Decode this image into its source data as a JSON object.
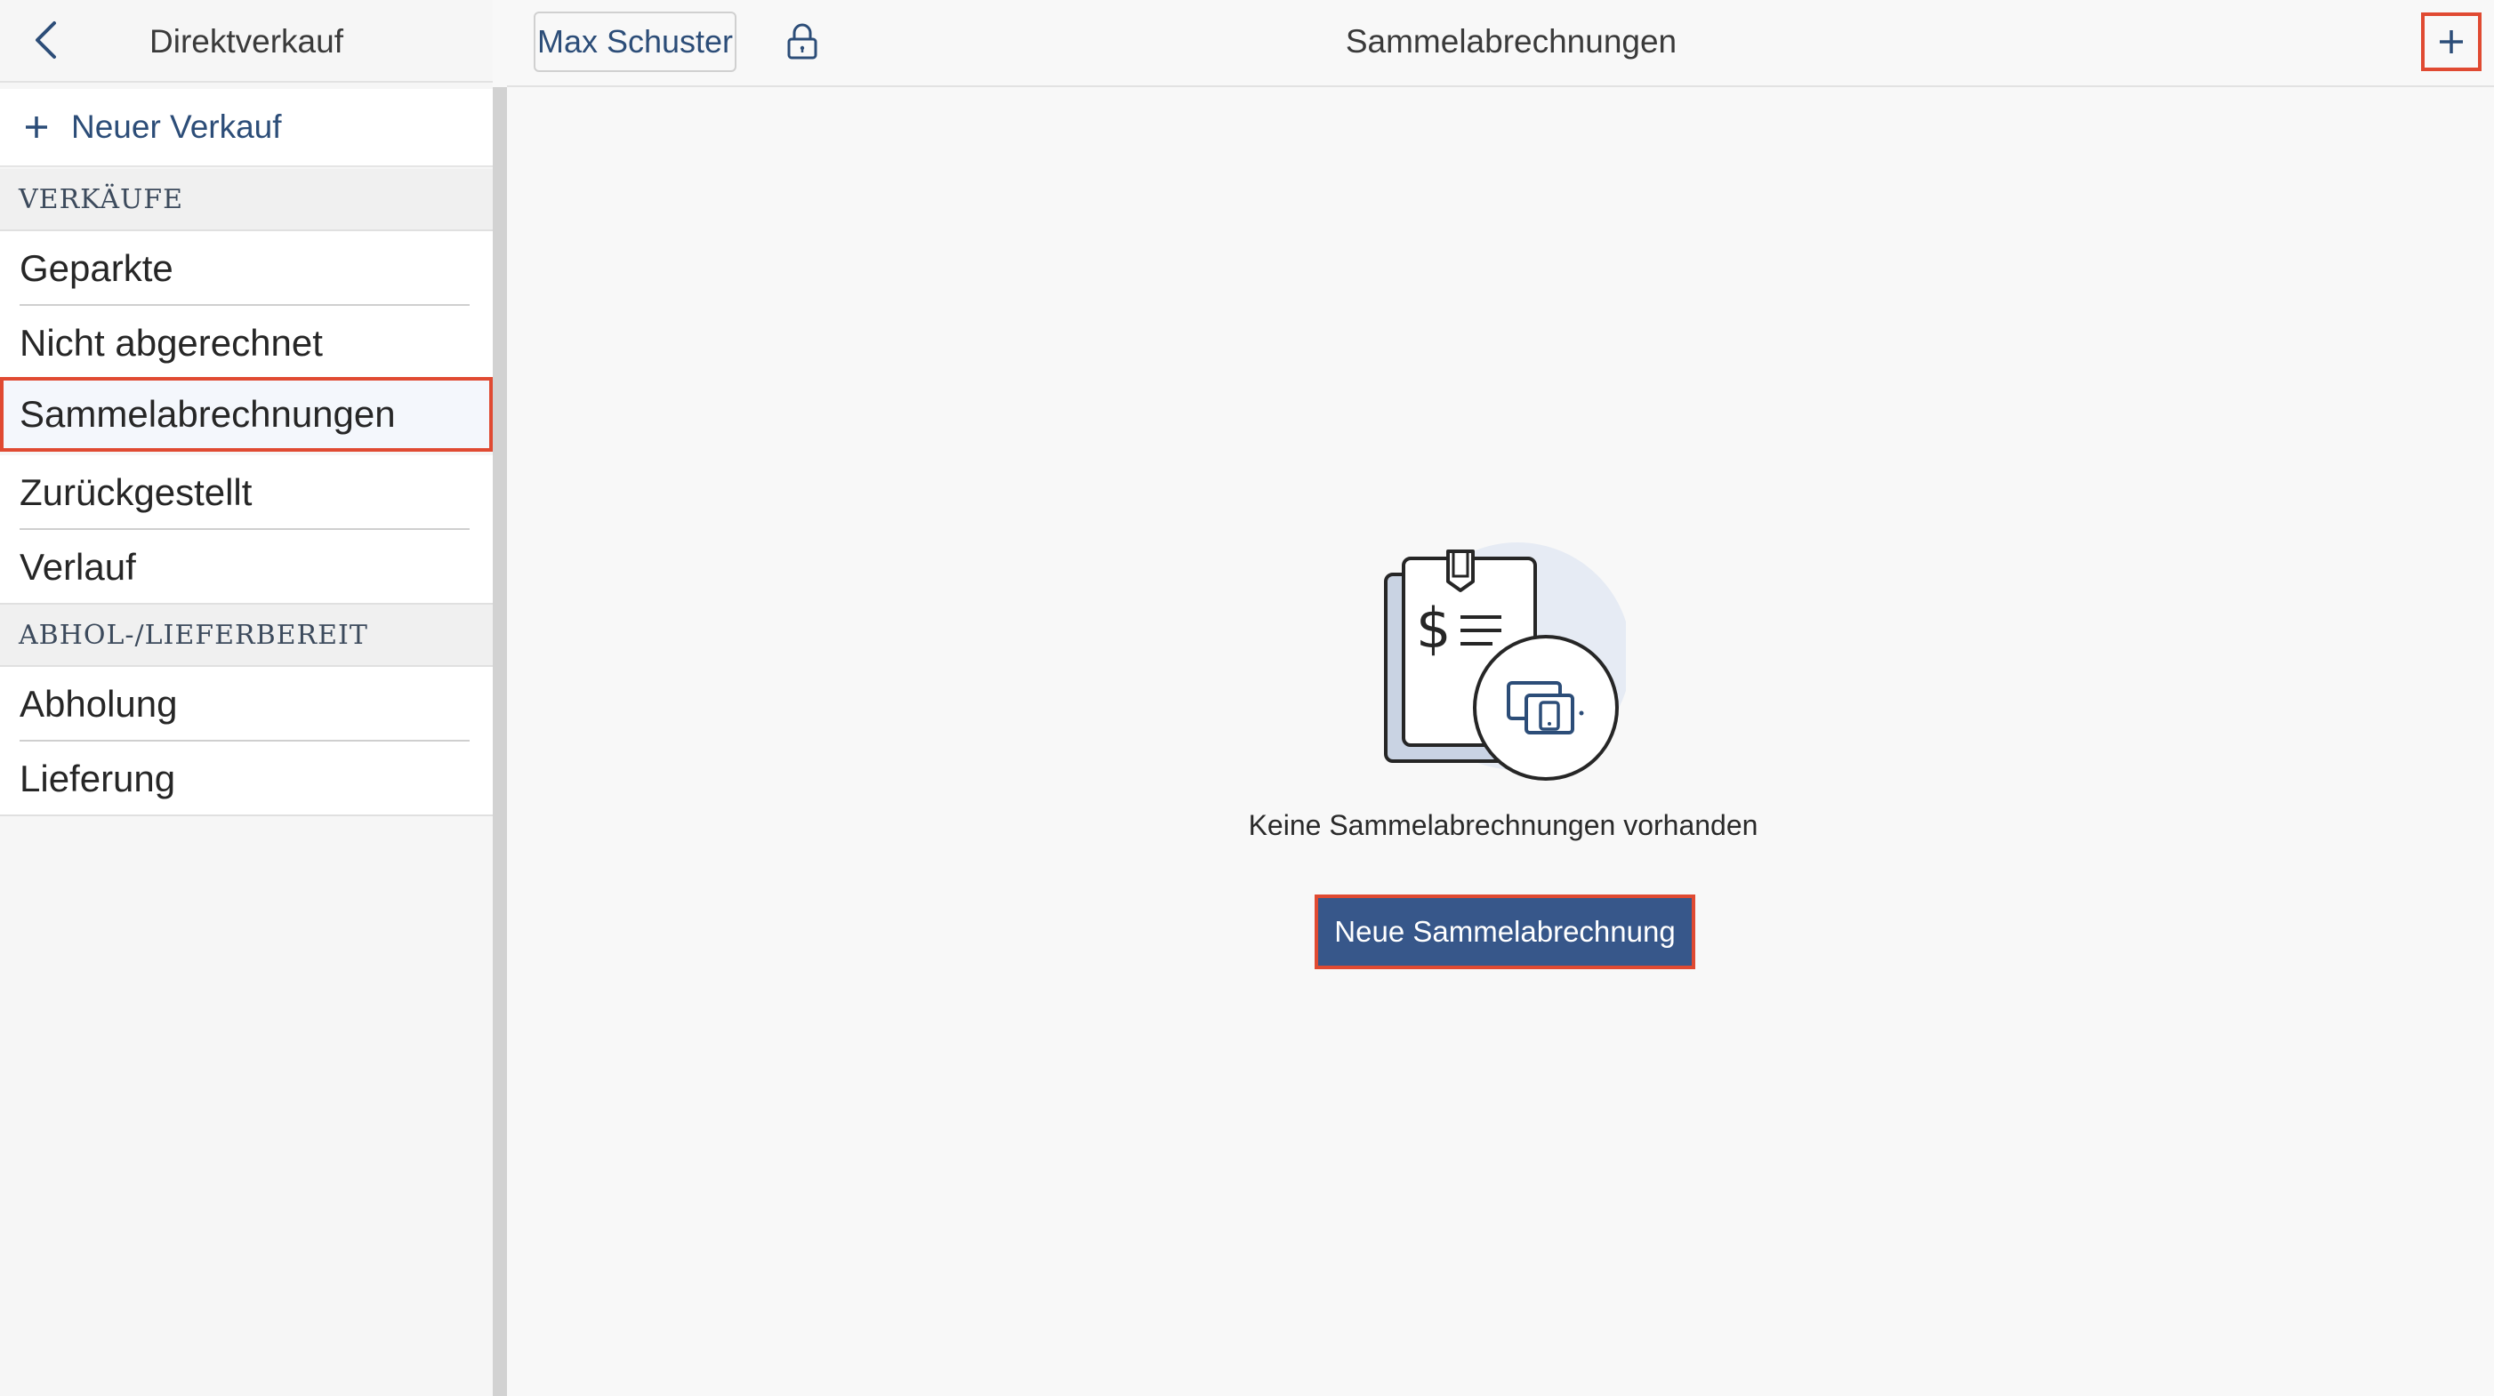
{
  "sidebar": {
    "title": "Direktverkauf",
    "new_sale_label": "Neuer Verkauf",
    "sections": [
      {
        "header": "VERKÄUFE",
        "items": [
          "Geparkte",
          "Nicht abgerechnet",
          "Sammelabrechnungen",
          "Zurückgestellt",
          "Verlauf"
        ]
      },
      {
        "header": "ABHOL-/LIEFERBEREIT",
        "items": [
          "Abholung",
          "Lieferung"
        ]
      }
    ],
    "active_item": "Sammelabrechnungen"
  },
  "header": {
    "user_label": "Max Schuster",
    "title": "Sammelabrechnungen"
  },
  "main": {
    "empty_text": "Keine Sammelabrechnungen vorhanden",
    "primary_button_label": "Neue Sammelabrechnung"
  },
  "icons": {
    "back": "chevron-left-icon",
    "new_sale": "plus-icon",
    "lock": "lock-icon",
    "add": "plus-icon",
    "illustration": "invoice-devices-illustration"
  },
  "colors": {
    "accent": "#2c4d78",
    "primary_button": "#37578a",
    "highlight_border": "#e04a32",
    "illustration_circle": "#e6ebf4"
  }
}
